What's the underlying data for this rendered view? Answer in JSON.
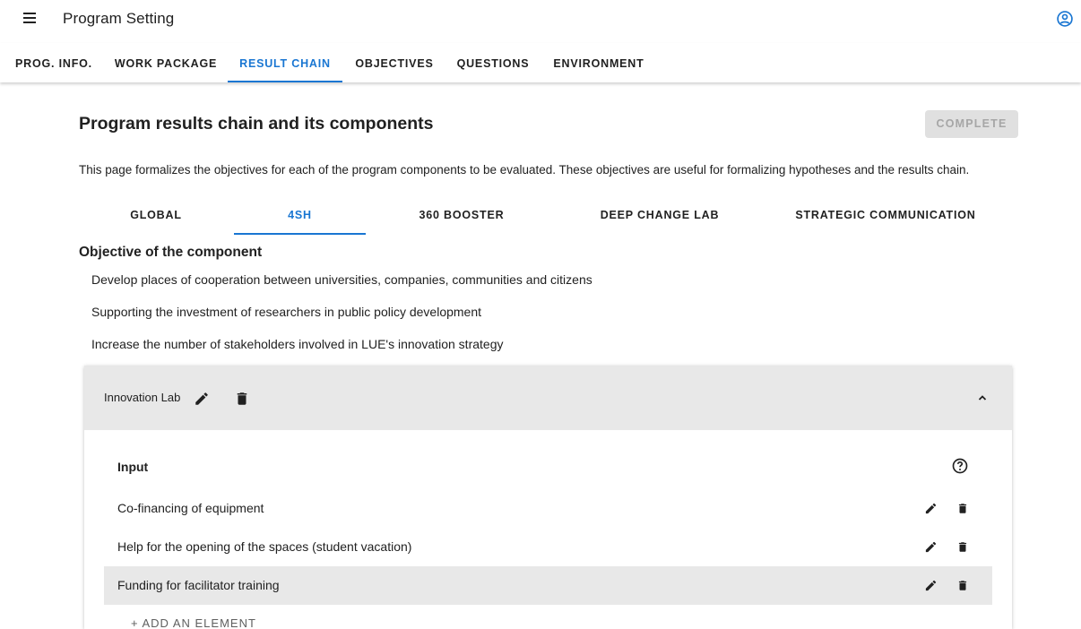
{
  "app": {
    "title": "Program Setting"
  },
  "main_tabs": [
    {
      "label": "PROG. INFO."
    },
    {
      "label": "WORK PACKAGE"
    },
    {
      "label": "RESULT CHAIN"
    },
    {
      "label": "OBJECTIVES"
    },
    {
      "label": "QUESTIONS"
    },
    {
      "label": "ENVIRONMENT"
    }
  ],
  "main_tabs_active": "RESULT CHAIN",
  "page": {
    "title": "Program results chain and its components",
    "complete_label": "COMPLETE",
    "description": "This page formalizes the objectives for each of the program components to be evaluated. These objectives are useful for formalizing hypotheses and the results chain."
  },
  "component_tabs": [
    {
      "label": "GLOBAL"
    },
    {
      "label": "4SH"
    },
    {
      "label": "360 BOOSTER"
    },
    {
      "label": "DEEP CHANGE LAB"
    },
    {
      "label": "STRATEGIC COMMUNICATION"
    }
  ],
  "component_tabs_active": "4SH",
  "objective_section": {
    "title": "Objective of the component",
    "items": [
      "Develop places of cooperation between universities, companies, communities and citizens",
      "Supporting the investment of researchers in public policy development",
      "Increase the number of stakeholders involved in LUE's innovation strategy"
    ]
  },
  "accordion": {
    "title": "Innovation Lab",
    "input_section": {
      "title": "Input",
      "items": [
        {
          "label": "Co-financing of equipment"
        },
        {
          "label": "Help for the opening of the spaces (student vacation)"
        },
        {
          "label": "Funding for facilitator training",
          "selected": true
        }
      ],
      "add_label": "+ ADD AN ELEMENT"
    }
  },
  "colors": {
    "accent": "#1976d2",
    "text": "#212121",
    "header_bg": "#e8e8e8",
    "disabled_button_bg": "#e0e0e0",
    "disabled_button_text": "#a6a6a6"
  },
  "icons": {
    "menu": "menu-icon",
    "account": "account-circle-icon",
    "edit": "pencil-icon",
    "delete": "trash-icon",
    "expand": "chevron-up-icon",
    "help": "help-circle-icon"
  }
}
